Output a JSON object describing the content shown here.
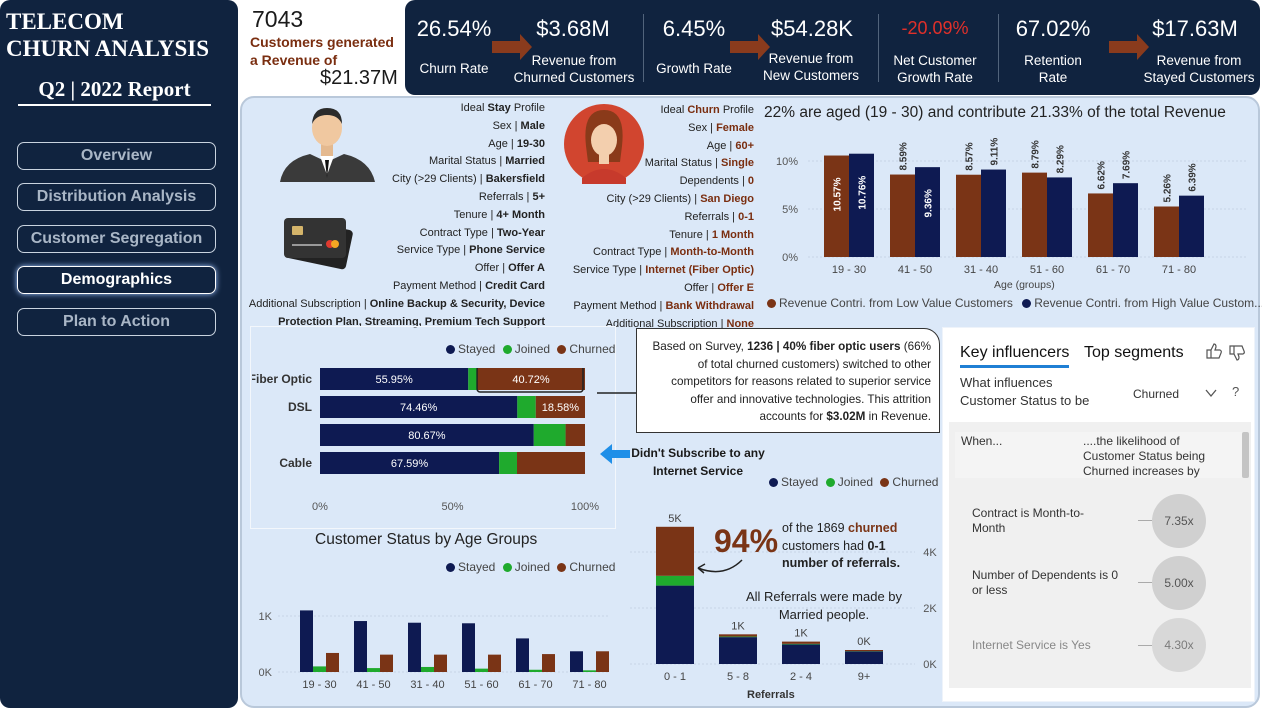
{
  "sidebar": {
    "title_line1": "TELECOM",
    "title_line2": "CHURN ANALYSIS",
    "report": "Q2 | 2022 Report",
    "nav": [
      "Overview",
      "Distribution Analysis",
      "Customer Segregation",
      "Demographics",
      "Plan to Action"
    ]
  },
  "summary": {
    "customers": "7043",
    "text": "Customers generated a Revenue of",
    "revenue": "$21.37M"
  },
  "kpis": [
    {
      "value": "26.54%",
      "label": "Churn Rate"
    },
    {
      "value": "$3.68M",
      "label": "Revenue from Churned Customers"
    },
    {
      "value": "6.45%",
      "label": "Growth Rate"
    },
    {
      "value": "$54.28K",
      "label": "Revenue from New Customers"
    },
    {
      "value": "-20.09%",
      "label": "Net Customer Growth Rate"
    },
    {
      "value": "67.02%",
      "label": "Retention Rate"
    },
    {
      "value": "$17.63M",
      "label": "Revenue from Stayed Customers"
    }
  ],
  "colors": {
    "stayed": "#0e1a52",
    "joined": "#1faa2d",
    "churned": "#7a3416",
    "negative": "#e0302a",
    "sidebar": "#10233f",
    "main_bg": "#dbe8f8"
  },
  "stay_profile": {
    "heading_pre": "Ideal",
    "heading_key": "Stay",
    "heading_post": "Profile",
    "rows": [
      [
        "Sex",
        "Male"
      ],
      [
        "Age",
        "19-30"
      ],
      [
        "Marital Status",
        "Married"
      ],
      [
        "City (>29 Clients)",
        "Bakersfield"
      ],
      [
        "Referrals",
        "5+"
      ],
      [
        "Tenure",
        "4+ Month"
      ],
      [
        "Contract Type",
        "Two-Year"
      ],
      [
        "Service Type",
        "Phone Service"
      ],
      [
        "Offer",
        "Offer A"
      ],
      [
        "Payment Method",
        "Credit Card"
      ]
    ],
    "addl_label": "Additional Subscription",
    "addl_value1": "Online Backup & Security, Device",
    "addl_value2": "Protection Plan, Streaming, Premium Tech Support"
  },
  "churn_profile": {
    "heading_pre": "Ideal",
    "heading_key": "Churn",
    "heading_post": "Profile",
    "rows": [
      [
        "Sex",
        "Female"
      ],
      [
        "Age",
        "60+"
      ],
      [
        "Marital Status",
        "Single"
      ],
      [
        "Dependents",
        "0"
      ],
      [
        "City (>29 Clients)",
        "San Diego"
      ],
      [
        "Referrals",
        "0-1"
      ],
      [
        "Tenure",
        "1 Month"
      ],
      [
        "Contract Type",
        "Month-to-Month"
      ],
      [
        "Service Type",
        "Internet (Fiber Optic)"
      ],
      [
        "Offer",
        "Offer E"
      ],
      [
        "Payment Method",
        "Bank Withdrawal"
      ],
      [
        "Additional Subscription",
        "None"
      ]
    ]
  },
  "age_revenue_chart": {
    "title": "22% are aged (19 - 30) and contribute 21.33% of the total Revenue",
    "xlabel": "Age (groups)",
    "legend": [
      "Revenue Contri. from Low Value Customers",
      "Revenue Contri. from High Value Custom..."
    ],
    "yticks": [
      "10%",
      "5%",
      "0%"
    ]
  },
  "internet_chart": {
    "legend": [
      "Stayed",
      "Joined",
      "Churned"
    ],
    "xticks": [
      "0%",
      "50%",
      "100%"
    ]
  },
  "callout": {
    "p1": "Based on Survey,",
    "bold1": "1236 | 40% fiber optic users",
    "p2": "(66% of total churned customers) switched to other competitors for reasons related to superior service offer and innovative technologies. This attrition accounts for",
    "bold2": "$3.02M",
    "p3": "in Revenue."
  },
  "no_internet_note": "Didn't Subscribe to any Internet Service",
  "status_age_chart": {
    "title": "Customer Status by Age Groups",
    "legend": [
      "Stayed",
      "Joined",
      "Churned"
    ],
    "yticks": [
      "1K",
      "0K"
    ]
  },
  "referrals_chart": {
    "legend": [
      "Stayed",
      "Joined",
      "Churned"
    ],
    "xlabel": "Referrals",
    "yticks": [
      "4K",
      "2K",
      "0K"
    ],
    "big": "94%",
    "note_pre": "of the 1869",
    "note_churned": "churned",
    "note_mid": "customers had",
    "note_bold": "0-1 number of referrals.",
    "married_note": "All Referrals were made by Married people."
  },
  "key_influencers": {
    "tab1": "Key influencers",
    "tab2": "Top segments",
    "question": "What influences Customer Status to be",
    "selected": "Churned",
    "help": "?",
    "when": "When...",
    "likelihood": "....the likelihood of Customer Status being Churned increases by",
    "items": [
      {
        "label": "Contract is Month-to-Month",
        "value": "7.35x"
      },
      {
        "label": "Number of Dependents is 0 or less",
        "value": "5.00x"
      },
      {
        "label": "Internet Service is Yes",
        "value": "4.30x"
      }
    ]
  },
  "chart_data": [
    {
      "type": "bar",
      "title": "22% are aged (19 - 30) and contribute 21.33% of the total Revenue",
      "xlabel": "Age (groups)",
      "ylabel": "",
      "ylim": [
        0,
        12
      ],
      "categories": [
        "19 - 30",
        "41 - 50",
        "31 - 40",
        "51 - 60",
        "61 - 70",
        "71 - 80"
      ],
      "series": [
        {
          "name": "Revenue Contri. from Low Value Customers",
          "values": [
            10.57,
            8.59,
            8.57,
            8.79,
            6.62,
            5.26
          ],
          "labels": [
            "10.57%",
            "8.59%",
            "8.57%",
            "8.79%",
            "6.62%",
            "5.26%"
          ]
        },
        {
          "name": "Revenue Contri. from High Value Custom...",
          "values": [
            10.76,
            9.36,
            9.11,
            8.29,
            7.69,
            6.39
          ],
          "labels": [
            "10.76%",
            "9.36%",
            "9.11%",
            "8.29%",
            "7.69%",
            "6.39%"
          ]
        }
      ]
    },
    {
      "type": "bar",
      "orientation": "horizontal",
      "stacked": true,
      "title": "",
      "xlim": [
        0,
        100
      ],
      "categories": [
        "Fiber Optic",
        "DSL",
        "",
        "Cable"
      ],
      "series": [
        {
          "name": "Stayed",
          "values": [
            55.95,
            74.46,
            80.67,
            67.59
          ],
          "labels": [
            "55.95%",
            "74.46%",
            "80.67%",
            "67.59%"
          ]
        },
        {
          "name": "Joined",
          "values": [
            3.33,
            6.96,
            12.0,
            6.75
          ]
        },
        {
          "name": "Churned",
          "values": [
            40.72,
            18.58,
            7.33,
            25.66
          ],
          "labels": [
            "40.72%",
            "18.58%",
            "",
            ""
          ]
        }
      ]
    },
    {
      "type": "bar",
      "title": "Customer Status by Age Groups",
      "ylim": [
        0,
        1.3
      ],
      "categories": [
        "19 - 30",
        "41 - 50",
        "31 - 40",
        "51 - 60",
        "61 - 70",
        "71 - 80"
      ],
      "series": [
        {
          "name": "Stayed",
          "values": [
            1.1,
            0.91,
            0.88,
            0.87,
            0.6,
            0.37
          ]
        },
        {
          "name": "Joined",
          "values": [
            0.1,
            0.07,
            0.09,
            0.06,
            0.04,
            0.03
          ]
        },
        {
          "name": "Churned",
          "values": [
            0.34,
            0.31,
            0.31,
            0.31,
            0.32,
            0.37
          ]
        }
      ]
    },
    {
      "type": "bar",
      "stacked": true,
      "title": "",
      "xlabel": "Referrals",
      "ylim": [
        0,
        5
      ],
      "categories": [
        "0 - 1",
        "5 - 8",
        "2 - 4",
        "9+"
      ],
      "series": [
        {
          "name": "Stayed",
          "values": [
            2.8,
            0.96,
            0.7,
            0.45
          ]
        },
        {
          "name": "Joined",
          "values": [
            0.35,
            0.02,
            0.02,
            0.01
          ]
        },
        {
          "name": "Churned",
          "values": [
            1.75,
            0.08,
            0.08,
            0.04
          ]
        }
      ],
      "totals": [
        "5K",
        "1K",
        "1K",
        "0K"
      ]
    }
  ]
}
